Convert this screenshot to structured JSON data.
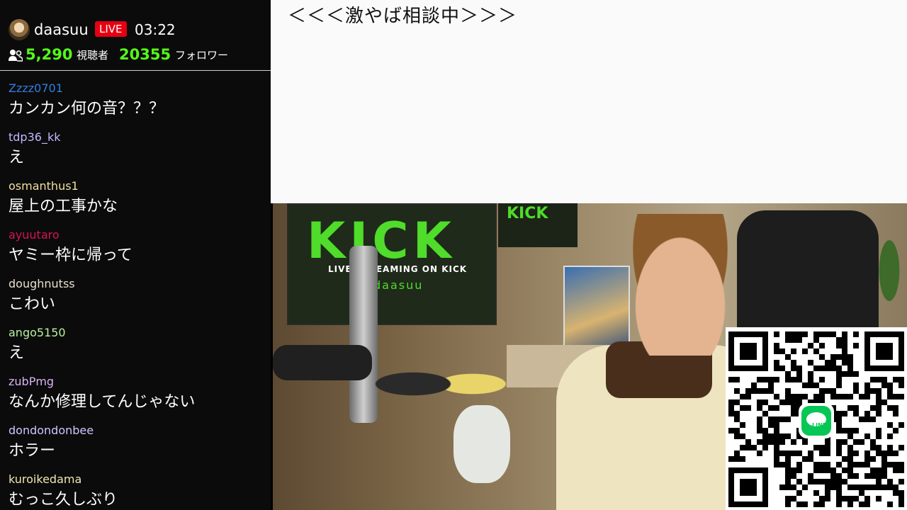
{
  "header": {
    "streamer": "daasuu",
    "live_label": "LIVE",
    "elapsed": "03:22",
    "viewer_count": "5,290",
    "viewer_label": "視聴者",
    "follower_count": "20355",
    "follower_label": "フォロワー"
  },
  "chat": [
    {
      "user": "Zzzz0701",
      "color": "#2f7fe0",
      "text": "カンカン何の音？？？"
    },
    {
      "user": "tdp36_kk",
      "color": "#c3b8ff",
      "text": "え"
    },
    {
      "user": "osmanthus1",
      "color": "#f2dfa0",
      "text": "屋上の工事かな"
    },
    {
      "user": "ayuutaro",
      "color": "#d4145a",
      "text": "ヤミー枠に帰って"
    },
    {
      "user": "doughnutss",
      "color": "#e8e0d0",
      "text": "こわい"
    },
    {
      "user": "ango5150",
      "color": "#b6f29e",
      "text": "え"
    },
    {
      "user": "zubPmg",
      "color": "#d9b3f5",
      "text": "なんか修理してんじゃない"
    },
    {
      "user": "dondondonbee",
      "color": "#d3c3ff",
      "text": "ホラー"
    },
    {
      "user": "kuroikedama",
      "color": "#f1e6b0",
      "text": "むっこ久しぶり"
    }
  ],
  "notice": {
    "text": "＜＜＜激やば相談中＞＞＞"
  },
  "camera": {
    "poster_title": "KICK",
    "poster_line1": "LIVE STREAMING ON KICK",
    "poster_line2": "daasuu",
    "poster_small": "KICK"
  },
  "qr": {
    "badge": "LINE"
  },
  "colors": {
    "accent_green": "#53fc18",
    "live_red": "#e60012",
    "line_green": "#06c755"
  }
}
